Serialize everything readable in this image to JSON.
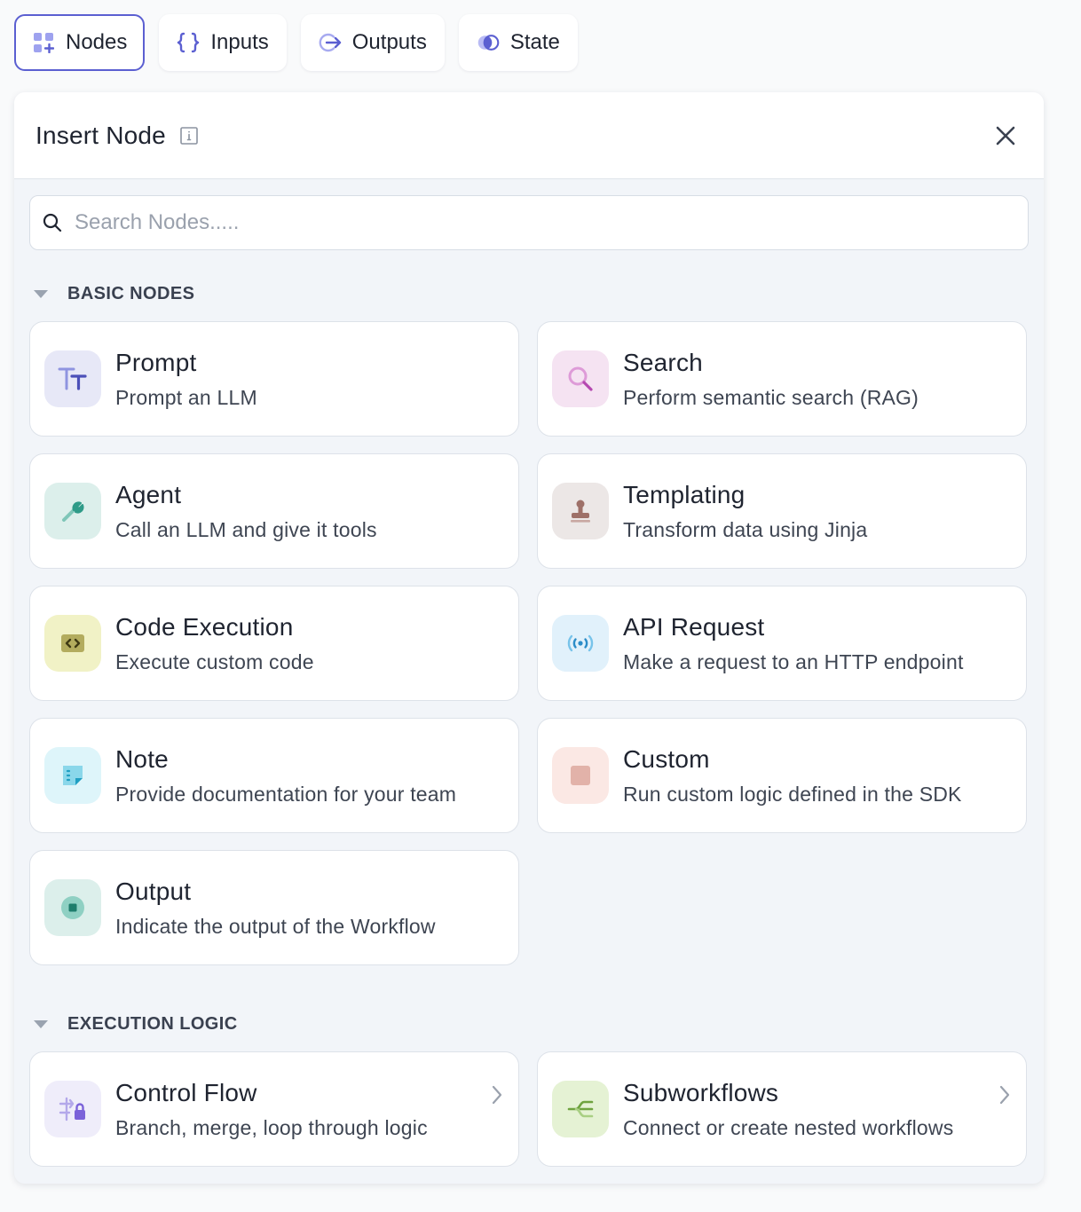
{
  "tabs": [
    {
      "label": "Nodes",
      "icon": "nodes-icon",
      "active": true
    },
    {
      "label": "Inputs",
      "icon": "braces-icon",
      "active": false
    },
    {
      "label": "Outputs",
      "icon": "arrow-right-circle-icon",
      "active": false
    },
    {
      "label": "State",
      "icon": "state-circles-icon",
      "active": false
    }
  ],
  "panel": {
    "title": "Insert Node",
    "search_placeholder": "Search Nodes....."
  },
  "sections": [
    {
      "title": "BASIC NODES",
      "nodes": [
        {
          "title": "Prompt",
          "desc": "Prompt an LLM",
          "icon": "text-type-icon"
        },
        {
          "title": "Search",
          "desc": "Perform semantic search (RAG)",
          "icon": "search-icon"
        },
        {
          "title": "Agent",
          "desc": "Call an LLM and give it tools",
          "icon": "wrench-icon"
        },
        {
          "title": "Templating",
          "desc": "Transform data using Jinja",
          "icon": "stamp-icon"
        },
        {
          "title": "Code Execution",
          "desc": "Execute custom code",
          "icon": "code-icon"
        },
        {
          "title": "API Request",
          "desc": "Make a request to an HTTP endpoint",
          "icon": "broadcast-icon"
        },
        {
          "title": "Note",
          "desc": "Provide documentation for your team",
          "icon": "note-icon"
        },
        {
          "title": "Custom",
          "desc": "Run custom logic defined in the SDK",
          "icon": "square-icon"
        },
        {
          "title": "Output",
          "desc": "Indicate the output of the Workflow",
          "icon": "output-stop-icon"
        }
      ]
    },
    {
      "title": "EXECUTION LOGIC",
      "nodes": [
        {
          "title": "Control Flow",
          "desc": "Branch, merge, loop through logic",
          "icon": "control-flow-icon"
        },
        {
          "title": "Subworkflows",
          "desc": "Connect or create nested workflows",
          "icon": "subworkflow-icon"
        }
      ]
    }
  ],
  "colors": {
    "accent": "#5b5fd1",
    "panel_bg": "#f2f5f9",
    "card_border": "#dde2e9"
  }
}
